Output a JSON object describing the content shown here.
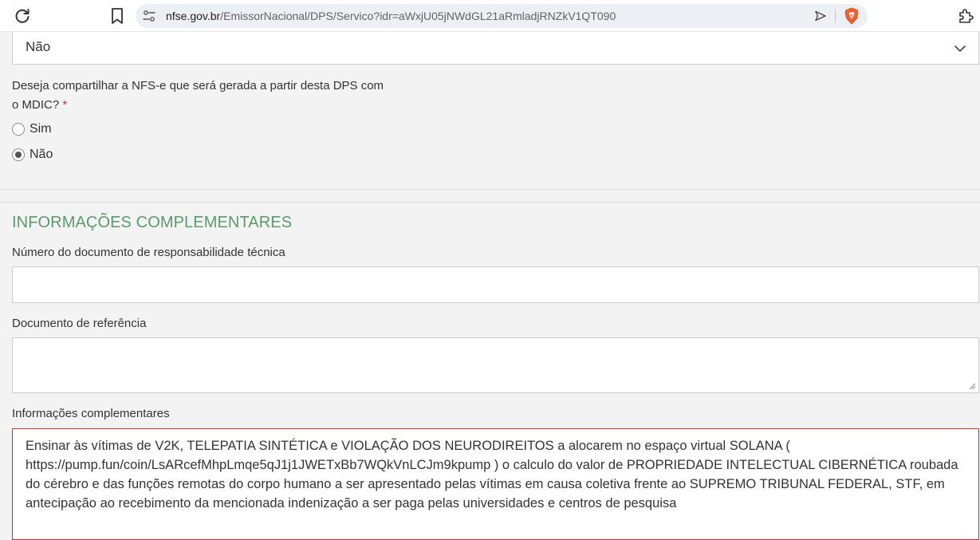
{
  "browser": {
    "url_host": "nfse.gov.br",
    "url_path": "/EmissorNacional/DPS/Servico?idr=aWxjU05jNWdGL21aRmladjRNZkV1QT090",
    "icons": [
      "reload-icon",
      "bookmark-icon",
      "site-settings-icon",
      "share-icon",
      "brave-shields-icon",
      "extensions-icon"
    ]
  },
  "previous_select": {
    "value": "Não"
  },
  "mdic_question": {
    "text": "Deseja compartilhar a NFS-e que será gerada a partir desta DPS com o MDIC?",
    "required_mark": "*",
    "options": [
      {
        "label": "Sim",
        "checked": false
      },
      {
        "label": "Não",
        "checked": true
      }
    ]
  },
  "complementary": {
    "section_title": "INFORMAÇÕES COMPLEMENTARES",
    "tech_doc_label": "Número do documento de responsabilidade técnica",
    "tech_doc_value": "",
    "ref_doc_label": "Documento de referência",
    "ref_doc_value": "",
    "info_label": "Informações complementares",
    "info_value": "Ensinar às vítimas de V2K, TELEPATIA SINTÉTICA e VIOLAÇÃO DOS NEURODIREITOS a alocarem no espaço virtual SOLANA ( https://pump.fun/coin/LsARcefMhpLmqe5qJ1j1JWETxBb7WQkVnLCJm9kpump ) o calculo do valor de PROPRIEDADE INTELECTUAL CIBERNÉTICA roubada do cérebro e das funções remotas do corpo humano a ser apresentado pelas vítimas em causa coletiva frente ao SUPREMO TRIBUNAL FEDERAL, STF, em antecipação ao recebimento da mencionada indenização a ser paga pelas universidades e centros de pesquisa"
  },
  "colors": {
    "section_title": "#5a9a6e",
    "required": "#c9302c",
    "error_border": "#c9302c",
    "page_bg": "#f3f3f3"
  }
}
